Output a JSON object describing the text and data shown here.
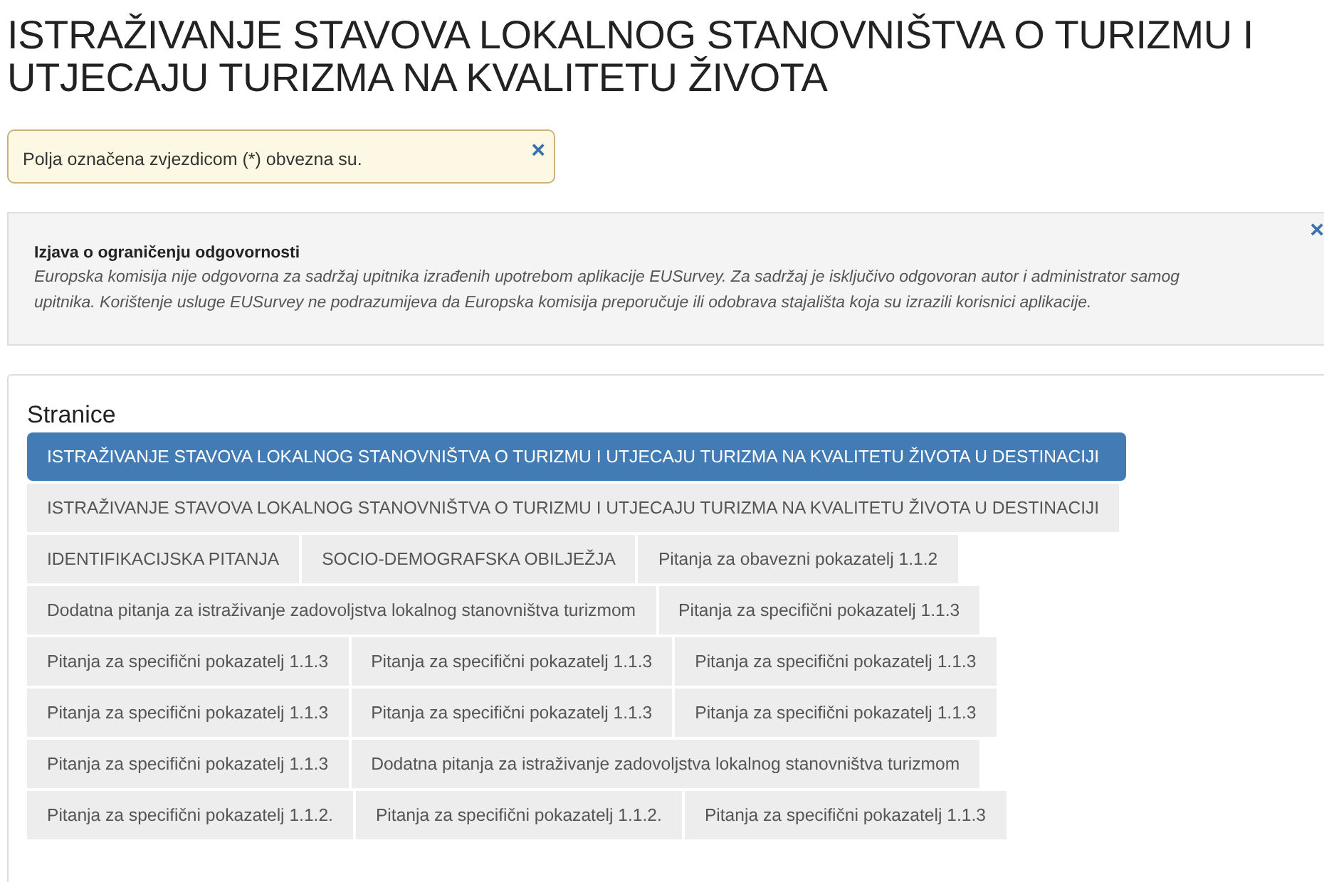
{
  "title": "ISTRAŽIVANJE STAVOVA LOKALNOG STANOVNIŠTVA O TURIZMU I UTJECAJU TURIZMA NA KVALITETU ŽIVOTA",
  "required_notice": {
    "text": "Polja označena zvjezdicom (*) obvezna su.",
    "close": "×"
  },
  "disclaimer": {
    "heading": "Izjava o ograničenju odgovornosti",
    "text": "Europska komisija nije odgovorna za sadržaj upitnika izrađenih upotrebom aplikacije EUSurvey. Za sadržaj je isključivo odgovoran autor i administrator samog upitnika. Korištenje usluge EUSurvey ne podrazumijeva da Europska komisija preporučuje ili odobrava stajališta koja su izrazili korisnici aplikacije.",
    "close": "×"
  },
  "pages": {
    "heading": "Stranice",
    "items": [
      {
        "label": "ISTRAŽIVANJE STAVOVA LOKALNOG STANOVNIŠTVA O TURIZMU I UTJECAJU TURIZMA NA KVALITETU ŽIVOTA U DESTINACIJI",
        "selected": true
      },
      {
        "label": "ISTRAŽIVANJE STAVOVA LOKALNOG STANOVNIŠTVA O TURIZMU I UTJECAJU TURIZMA NA KVALITETU ŽIVOTA U DESTINACIJI",
        "selected": false
      },
      {
        "label": "IDENTIFIKACIJSKA PITANJA",
        "selected": false
      },
      {
        "label": "SOCIO-DEMOGRAFSKA OBILJEŽJA",
        "selected": false
      },
      {
        "label": "Pitanja za obavezni pokazatelj 1.1.2",
        "selected": false
      },
      {
        "label": "Dodatna pitanja za istraživanje zadovoljstva lokalnog stanovništva turizmom",
        "selected": false
      },
      {
        "label": "Pitanja za specifični pokazatelj 1.1.3",
        "selected": false
      },
      {
        "label": "Pitanja za specifični pokazatelj 1.1.3",
        "selected": false
      },
      {
        "label": "Pitanja za specifični pokazatelj 1.1.3",
        "selected": false
      },
      {
        "label": "Pitanja za specifični pokazatelj 1.1.3",
        "selected": false
      },
      {
        "label": "Pitanja za specifični pokazatelj 1.1.3",
        "selected": false
      },
      {
        "label": "Pitanja za specifični pokazatelj 1.1.3",
        "selected": false
      },
      {
        "label": "Pitanja za specifični pokazatelj 1.1.3",
        "selected": false
      },
      {
        "label": "Pitanja za specifični pokazatelj 1.1.3",
        "selected": false
      },
      {
        "label": "Dodatna pitanja za istraživanje zadovoljstva lokalnog stanovništva turizmom",
        "selected": false
      },
      {
        "label": "Pitanja za specifični pokazatelj 1.1.2.",
        "selected": false
      },
      {
        "label": "Pitanja za specifični pokazatelj 1.1.2.",
        "selected": false
      },
      {
        "label": "Pitanja za specifični pokazatelj 1.1.3",
        "selected": false
      }
    ]
  }
}
